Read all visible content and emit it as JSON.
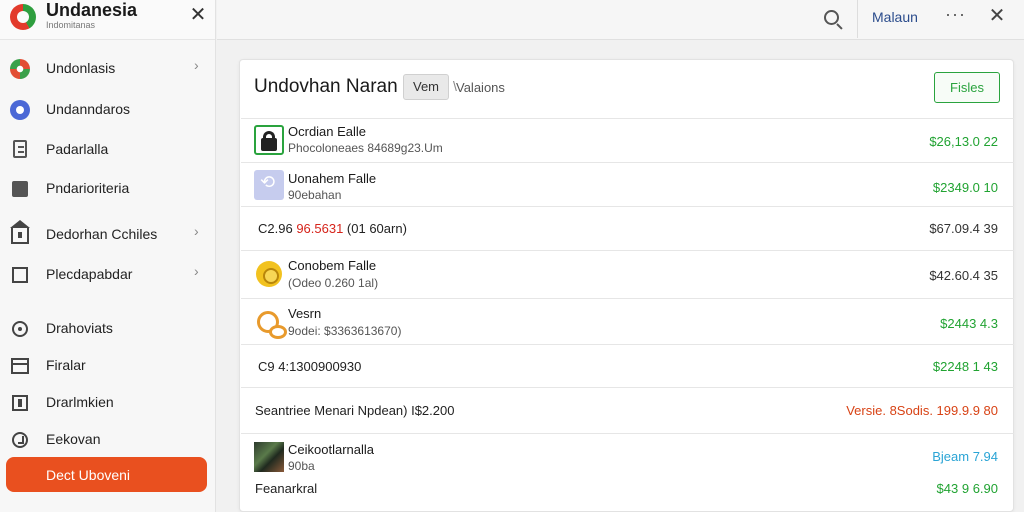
{
  "sidebar": {
    "brand_name": "Undanesia",
    "brand_sub": "Indomitanas",
    "items": [
      {
        "label": "Undonlasis",
        "icon": "flower-logo-icon",
        "chevron": "›"
      },
      {
        "label": "Undanndaros",
        "icon": "blue-circle-icon"
      },
      {
        "label": "Padarlalla",
        "icon": "document-icon"
      },
      {
        "label": "Pndarioriteria",
        "icon": "tag-icon"
      },
      {
        "label": "Dedorhan Cchiles",
        "icon": "home-icon",
        "chevron": "›"
      },
      {
        "label": "Plecdapabdar",
        "icon": "edit-icon",
        "chevron": "›"
      },
      {
        "label": "Drahoviats",
        "icon": "ring-icon"
      },
      {
        "label": "Firalar",
        "icon": "window-icon"
      },
      {
        "label": "Drarlmkien",
        "icon": "box-icon"
      },
      {
        "label": "Eekovan",
        "icon": "clock-icon"
      }
    ],
    "active_label": "Dect Uboveni"
  },
  "topbar": {
    "label": "Malaun",
    "more": "···"
  },
  "card": {
    "title": "Undovhan Naran",
    "tag": "Vem",
    "meta": "Valaions",
    "button": "Fisles",
    "rows": [
      {
        "title": "Ocrdian Ealle",
        "sub": "Phocoloneaes 84689g23.Um",
        "value": "$26,13.0 22",
        "color": "green",
        "icon": "lock-icon"
      },
      {
        "title": "Uonahem Falle",
        "sub": "90ebahan",
        "value": "$2349.0 10",
        "color": "green",
        "icon": "link-icon"
      },
      {
        "single_pre": "C2.96 ",
        "single_hl": "96.5631",
        "single_post": " (01 60arn)",
        "value": "$67.09.4 39",
        "color": "dark"
      },
      {
        "title": "Conobem Falle",
        "sub": "(Odeo 0.260 1al)",
        "value": "$42.60.4 35",
        "color": "dark",
        "icon": "coin-icon"
      },
      {
        "title": "Vesrn",
        "sub": "9odei: $3363613670)",
        "value": "$2443 4.3",
        "color": "green",
        "icon": "ring-icon"
      },
      {
        "single_pre": "C9 4:1300900930",
        "value": "$2248 1 43",
        "color": "green"
      },
      {
        "single_pre": "Seantriee Menari Npdean) I$2.200",
        "value": "Versie. 8Sodis.  199.9.9 80",
        "color": "orange"
      },
      {
        "title": "Ceikootlarnalla",
        "sub": "90ba",
        "extra": "Feanarkral",
        "value": "Bjeam 7.94",
        "value2": "$43 9 6.90",
        "color": "blue",
        "icon": "photo-icon"
      }
    ]
  }
}
